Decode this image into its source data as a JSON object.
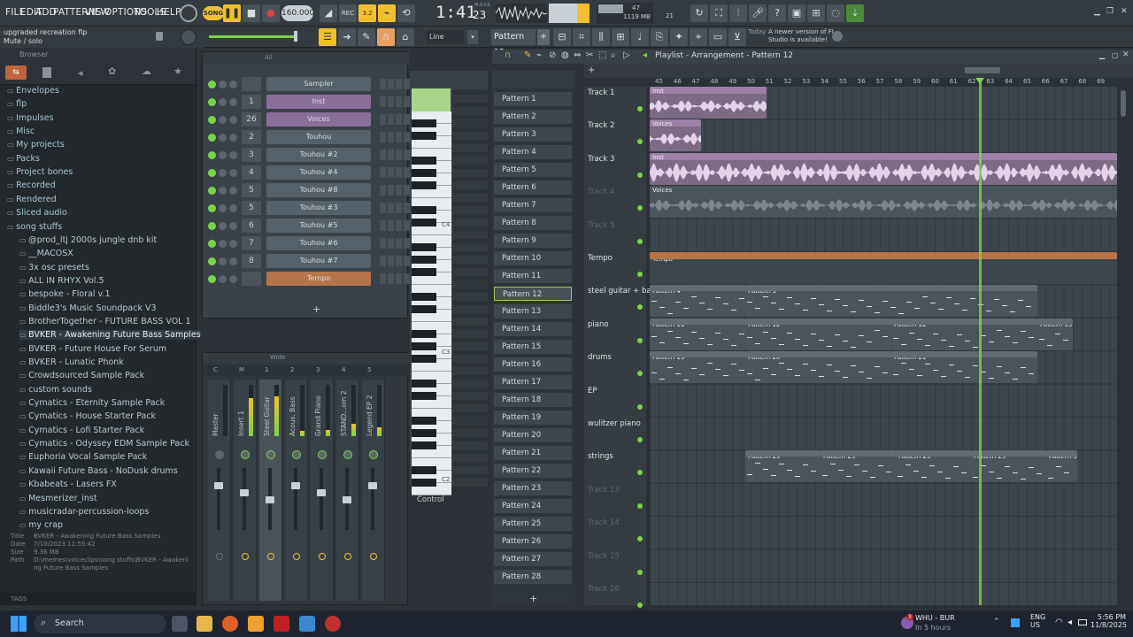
{
  "menu": [
    "FILE",
    "EDIT",
    "ADD",
    "PATTERNS",
    "VIEW",
    "OPTIONS",
    "TOOLS",
    "HELP"
  ],
  "transport": {
    "mode": "SONG",
    "tempo": "160.000",
    "time": "1:41",
    "time_fraction": "23",
    "time_unit": "M:S:CS"
  },
  "cpu": {
    "memory": "1119 MB",
    "voices": "47",
    "cpu_sub": "21"
  },
  "hint": {
    "project": "upgraded recreation flp",
    "action": "Mute / solo"
  },
  "snap": "Line",
  "current_pattern": "Pattern 12",
  "news": {
    "when": "Today",
    "text": "A newer version of FL Studio is available!"
  },
  "browser": {
    "title": "Browser",
    "items": [
      {
        "label": "Envelopes",
        "level": 0
      },
      {
        "label": "flp",
        "level": 0
      },
      {
        "label": "Impulses",
        "level": 0
      },
      {
        "label": "Misc",
        "level": 0
      },
      {
        "label": "My projects",
        "level": 0
      },
      {
        "label": "Packs",
        "level": 0
      },
      {
        "label": "Project bones",
        "level": 0
      },
      {
        "label": "Recorded",
        "level": 0
      },
      {
        "label": "Rendered",
        "level": 0
      },
      {
        "label": "Sliced audio",
        "level": 0
      },
      {
        "label": "song stuffs",
        "level": 0
      },
      {
        "label": "@prod_ltj 2000s jungle dnb kit",
        "level": 1
      },
      {
        "label": "__MACOSX",
        "level": 1
      },
      {
        "label": "3x osc presets",
        "level": 1
      },
      {
        "label": "ALL IN RHYX Vol.5",
        "level": 1
      },
      {
        "label": "bespoke - Floral v.1",
        "level": 1
      },
      {
        "label": "Biddle3's Music Soundpack V3",
        "level": 1
      },
      {
        "label": "BrotherTogether - FUTURE BASS VOL 1",
        "level": 1
      },
      {
        "label": "BVKER - Awakening Future Bass Samples",
        "level": 1,
        "selected": true
      },
      {
        "label": "BVKER - Future House For Serum",
        "level": 1
      },
      {
        "label": "BVKER - Lunatic Phonk",
        "level": 1
      },
      {
        "label": "Crowdsourced Sample Pack",
        "level": 1
      },
      {
        "label": "custom sounds",
        "level": 1
      },
      {
        "label": "Cymatics - Eternity Sample Pack",
        "level": 1
      },
      {
        "label": "Cymatics - House Starter Pack",
        "level": 1
      },
      {
        "label": "Cymatics - Lofi Starter Pack",
        "level": 1
      },
      {
        "label": "Cymatics - Odyssey EDM Sample Pack",
        "level": 1
      },
      {
        "label": "Euphoria Vocal Sample Pack",
        "level": 1
      },
      {
        "label": "Kawaii Future Bass - NoDusk drums",
        "level": 1
      },
      {
        "label": "Kbabeats - Lasers FX",
        "level": 1
      },
      {
        "label": "Mesmerizer_inst",
        "level": 1
      },
      {
        "label": "musicradar-percussion-loops",
        "level": 1
      },
      {
        "label": "my crap",
        "level": 1
      }
    ],
    "info": {
      "title_label": "Title",
      "title": "BVKER - Awakening Future Bass Samples",
      "date_label": "Date",
      "date": "7/10/2023 11:55:42",
      "size_label": "Size",
      "size": "9.36 MB",
      "path_label": "Path",
      "path": "D:\\memes\\voiceclips\\song stuffs\\BVKER - Awakening Future Bass Samples"
    },
    "tags": "TAGS"
  },
  "channel_rack": {
    "filter": "All",
    "channels": [
      {
        "num": "",
        "name": "Sampler",
        "color": "gray"
      },
      {
        "num": "1",
        "name": "Inst",
        "color": "purple"
      },
      {
        "num": "26",
        "name": "Voices",
        "color": "purple"
      },
      {
        "num": "2",
        "name": "Touhou",
        "color": "gray"
      },
      {
        "num": "3",
        "name": "Touhou #2",
        "color": "gray"
      },
      {
        "num": "4",
        "name": "Touhou #4",
        "color": "gray"
      },
      {
        "num": "5",
        "name": "Touhou #8",
        "color": "gray"
      },
      {
        "num": "5",
        "name": "Touhou #3",
        "color": "gray"
      },
      {
        "num": "6",
        "name": "Touhou #5",
        "color": "gray"
      },
      {
        "num": "7",
        "name": "Touhou #6",
        "color": "gray"
      },
      {
        "num": "8",
        "name": "Touhou #7",
        "color": "gray"
      },
      {
        "num": "",
        "name": "Tempo",
        "color": "orange"
      }
    ]
  },
  "piano_labels": [
    "C4",
    "C3",
    "C2"
  ],
  "control_label": "Control",
  "mixer": {
    "view": "Wide",
    "header": [
      "C",
      "M",
      "1",
      "2",
      "3",
      "4",
      "5"
    ],
    "tracks": [
      "Master",
      "Insert 1",
      "Steel Guitar",
      "Acous. Bass",
      "Grand Piano",
      "STAND...om 2",
      "Legend EP 2"
    ]
  },
  "pattern_list": [
    "Pattern 1",
    "Pattern 2",
    "Pattern 3",
    "Pattern 4",
    "Pattern 5",
    "Pattern 6",
    "Pattern 7",
    "Pattern 8",
    "Pattern 9",
    "Pattern 10",
    "Pattern 11",
    "Pattern 12",
    "Pattern 13",
    "Pattern 14",
    "Pattern 15",
    "Pattern 16",
    "Pattern 17",
    "Pattern 18",
    "Pattern 19",
    "Pattern 20",
    "Pattern 21",
    "Pattern 22",
    "Pattern 23",
    "Pattern 24",
    "Pattern 25",
    "Pattern 26",
    "Pattern 27",
    "Pattern 28"
  ],
  "playlist": {
    "title": "Playlist - Arrangement - Pattern 12",
    "ruler": [
      "45",
      "46",
      "47",
      "48",
      "49",
      "50",
      "51",
      "52",
      "53",
      "54",
      "55",
      "56",
      "57",
      "58",
      "59",
      "60",
      "61",
      "62",
      "63",
      "64",
      "65",
      "66",
      "67",
      "68",
      "69"
    ],
    "tracks": [
      {
        "name": "Track 1",
        "dim": false
      },
      {
        "name": "Track 2",
        "dim": false
      },
      {
        "name": "Track 3",
        "dim": false
      },
      {
        "name": "Track 4",
        "dim": true
      },
      {
        "name": "Track 5",
        "dim": true
      },
      {
        "name": "Tempo",
        "dim": false
      },
      {
        "name": "steel guitar + bass",
        "dim": false
      },
      {
        "name": "piano",
        "dim": false
      },
      {
        "name": "drums",
        "dim": false
      },
      {
        "name": "EP",
        "dim": false
      },
      {
        "name": "wulitzer piano",
        "dim": false
      },
      {
        "name": "strings",
        "dim": false
      },
      {
        "name": "Track 13",
        "dim": true
      },
      {
        "name": "Track 14",
        "dim": true
      },
      {
        "name": "Track 15",
        "dim": true
      },
      {
        "name": "Track 16",
        "dim": true
      }
    ],
    "clips": [
      {
        "track": 0,
        "label": "Inst",
        "type": "audio"
      },
      {
        "track": 1,
        "label": "Voices",
        "type": "audio"
      },
      {
        "track": 2,
        "label": "Inst",
        "type": "audio"
      },
      {
        "track": 3,
        "label": "Voices",
        "type": "audio-muted"
      },
      {
        "track": 5,
        "label": "Tempo",
        "type": "automation"
      },
      {
        "track": 6,
        "label": "Pattern 4",
        "type": "pattern"
      },
      {
        "track": 6,
        "label": "Pattern 5",
        "type": "pattern"
      },
      {
        "track": 7,
        "label": "Pattern 11",
        "type": "pattern"
      },
      {
        "track": 7,
        "label": "Pattern 12",
        "type": "pattern"
      },
      {
        "track": 7,
        "label": "Pattern 12",
        "type": "pattern"
      },
      {
        "track": 7,
        "label": "Pattern 13",
        "type": "pattern"
      },
      {
        "track": 8,
        "label": "Pattern 19",
        "type": "pattern"
      },
      {
        "track": 8,
        "label": "Pattern 20",
        "type": "pattern"
      },
      {
        "track": 8,
        "label": "Pattern 21",
        "type": "pattern"
      },
      {
        "track": 11,
        "label": "Pattern 29",
        "type": "pattern"
      },
      {
        "track": 11,
        "label": "Pattern 29",
        "type": "pattern"
      },
      {
        "track": 11,
        "label": "Pattern 29",
        "type": "pattern"
      },
      {
        "track": 11,
        "label": "Pattern 29",
        "type": "pattern"
      },
      {
        "track": 11,
        "label": "Pattern 30",
        "type": "pattern"
      }
    ]
  },
  "taskbar": {
    "search": "Search",
    "weather_badge": "3",
    "weather_title": "WHU - BUR",
    "weather_sub": "In 5 hours",
    "lang": "ENG",
    "region": "US",
    "time": "5:56 PM",
    "date": "11/8/2025"
  },
  "colors": {
    "accent_green": "#7ed64a",
    "audio_clip": "#9d7fa8",
    "pattern_clip": "#606b74",
    "tempo_clip": "#b5744a"
  }
}
